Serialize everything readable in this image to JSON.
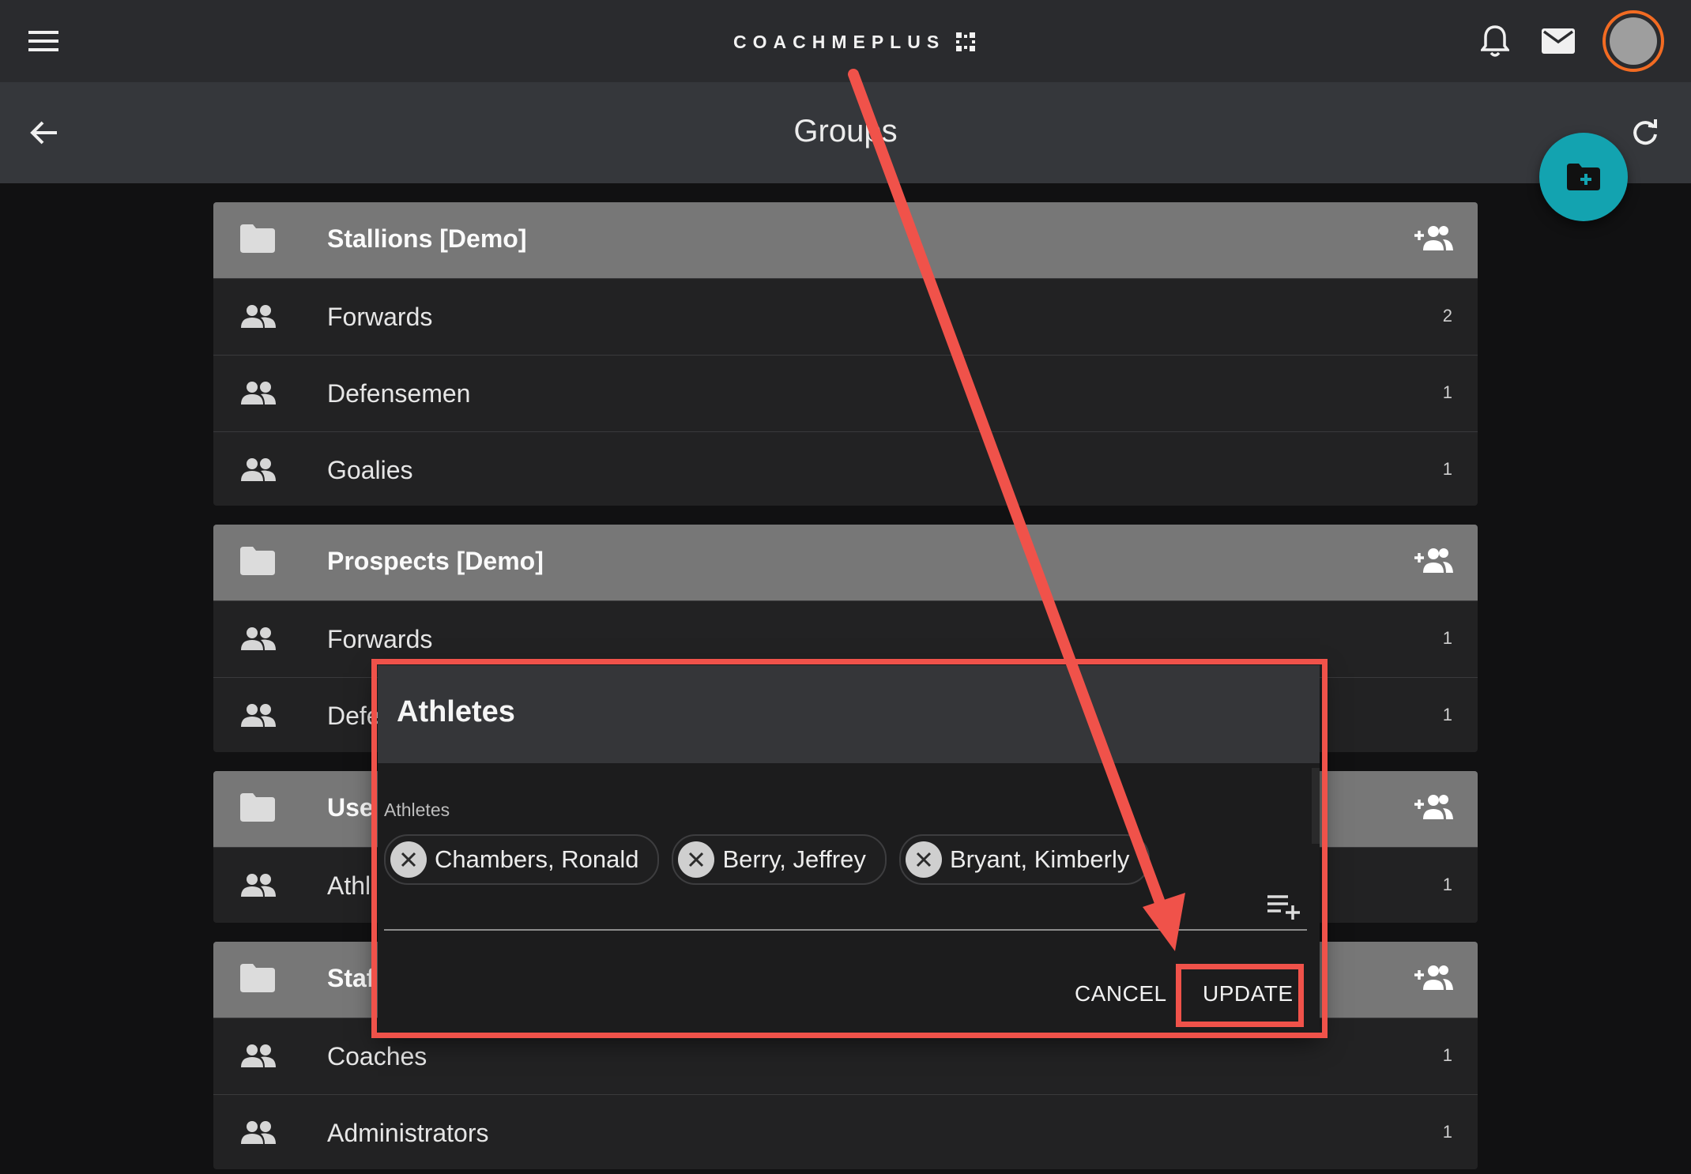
{
  "app": {
    "brand": "COACHMEPLUS"
  },
  "page": {
    "title": "Groups"
  },
  "colors": {
    "accent": "#13a3b0",
    "annotation": "#f0524a",
    "avatar_ring": "#f26b22"
  },
  "icons": {
    "menu": "menu-icon",
    "bell": "bell-icon",
    "mail": "mail-icon",
    "back": "arrow-back-icon",
    "refresh": "refresh-icon",
    "new_folder": "create-folder-icon",
    "folder": "folder-icon",
    "group": "group-icon",
    "add_person": "group-add-icon",
    "chip_remove": "close-circle-icon",
    "playlist_add": "playlist-add-icon"
  },
  "groups": [
    {
      "name": "Stallions [Demo]",
      "rows": [
        {
          "label": "Forwards",
          "count": "2"
        },
        {
          "label": "Defensemen",
          "count": "1"
        },
        {
          "label": "Goalies",
          "count": "1"
        }
      ]
    },
    {
      "name": "Prospects [Demo]",
      "rows": [
        {
          "label": "Forwards",
          "count": "1"
        },
        {
          "label": "Defe",
          "count": "1"
        }
      ]
    },
    {
      "name": "Use",
      "rows": [
        {
          "label": "Athl",
          "count": "1"
        }
      ]
    },
    {
      "name": "Staf",
      "rows": [
        {
          "label": "Coaches",
          "count": "1"
        },
        {
          "label": "Administrators",
          "count": "1"
        }
      ]
    }
  ],
  "dialog": {
    "title": "Athletes",
    "field_label": "Athletes",
    "chips": [
      "Chambers, Ronald",
      "Berry, Jeffrey",
      "Bryant, Kimberly"
    ],
    "cancel_label": "CANCEL",
    "update_label": "UPDATE"
  }
}
